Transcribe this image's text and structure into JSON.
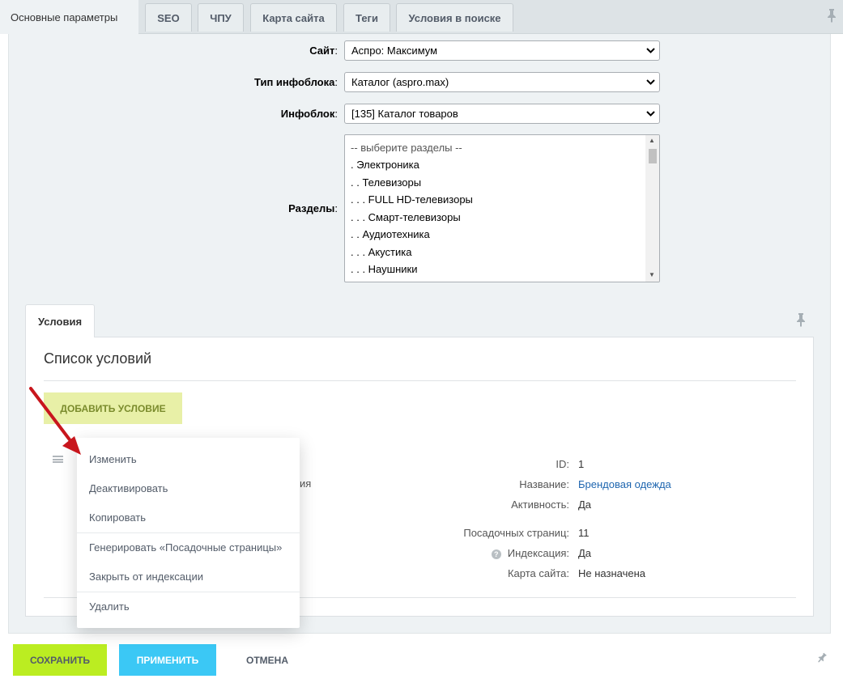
{
  "tabs": [
    {
      "label": "Основные параметры",
      "active": true
    },
    {
      "label": "SEO"
    },
    {
      "label": "ЧПУ"
    },
    {
      "label": "Карта сайта"
    },
    {
      "label": "Теги"
    },
    {
      "label": "Условия в поиске"
    }
  ],
  "form": {
    "site": {
      "label": "Сайт",
      "value": "Аспро: Максимум"
    },
    "iblock_type": {
      "label": "Тип инфоблока",
      "value": "Каталог (aspro.max)"
    },
    "iblock": {
      "label": "Инфоблок",
      "value": "[135] Каталог товаров"
    },
    "sections": {
      "label": "Разделы",
      "options": [
        "-- выберите разделы --",
        ". Электроника",
        ". . Телевизоры",
        ". . . FULL HD-телевизоры",
        ". . . Смарт-телевизоры",
        ". . Аудиотехника",
        ". . . Акустика",
        ". . . Наушники"
      ]
    }
  },
  "conditions": {
    "tab_label": "Условия",
    "list_title": "Список условий",
    "add_button": "ДОБАВИТЬ УСЛОВИЕ",
    "partial_text": "ия",
    "item": {
      "id_label": "ID:",
      "id_value": "1",
      "name_label": "Название:",
      "name_value": "Брендовая одежда",
      "active_label": "Активность:",
      "active_value": "Да",
      "landing_label": "Посадочных страниц:",
      "landing_value": "11",
      "indexing_label": "Индексация:",
      "indexing_value": "Да",
      "sitemap_label": "Карта сайта:",
      "sitemap_value": "Не назначена"
    }
  },
  "context_menu": {
    "items": [
      "Изменить",
      "Деактивировать",
      "Копировать",
      "Генерировать «Посадочные страницы»",
      "Закрыть от индексации",
      "Удалить"
    ]
  },
  "footer": {
    "save": "СОХРАНИТЬ",
    "apply": "ПРИМЕНИТЬ",
    "cancel": "ОТМЕНА"
  },
  "icons": {
    "pin": "pin-icon",
    "help": "help-icon",
    "menu": "hamburger-icon",
    "chevron": "chevron-down-icon"
  },
  "colors": {
    "save_button": "#bbed21",
    "apply_button": "#3bc8f5",
    "add_condition_button": "#e8f0a7",
    "link": "#2067b0",
    "annotation_arrow": "#c8161d"
  }
}
